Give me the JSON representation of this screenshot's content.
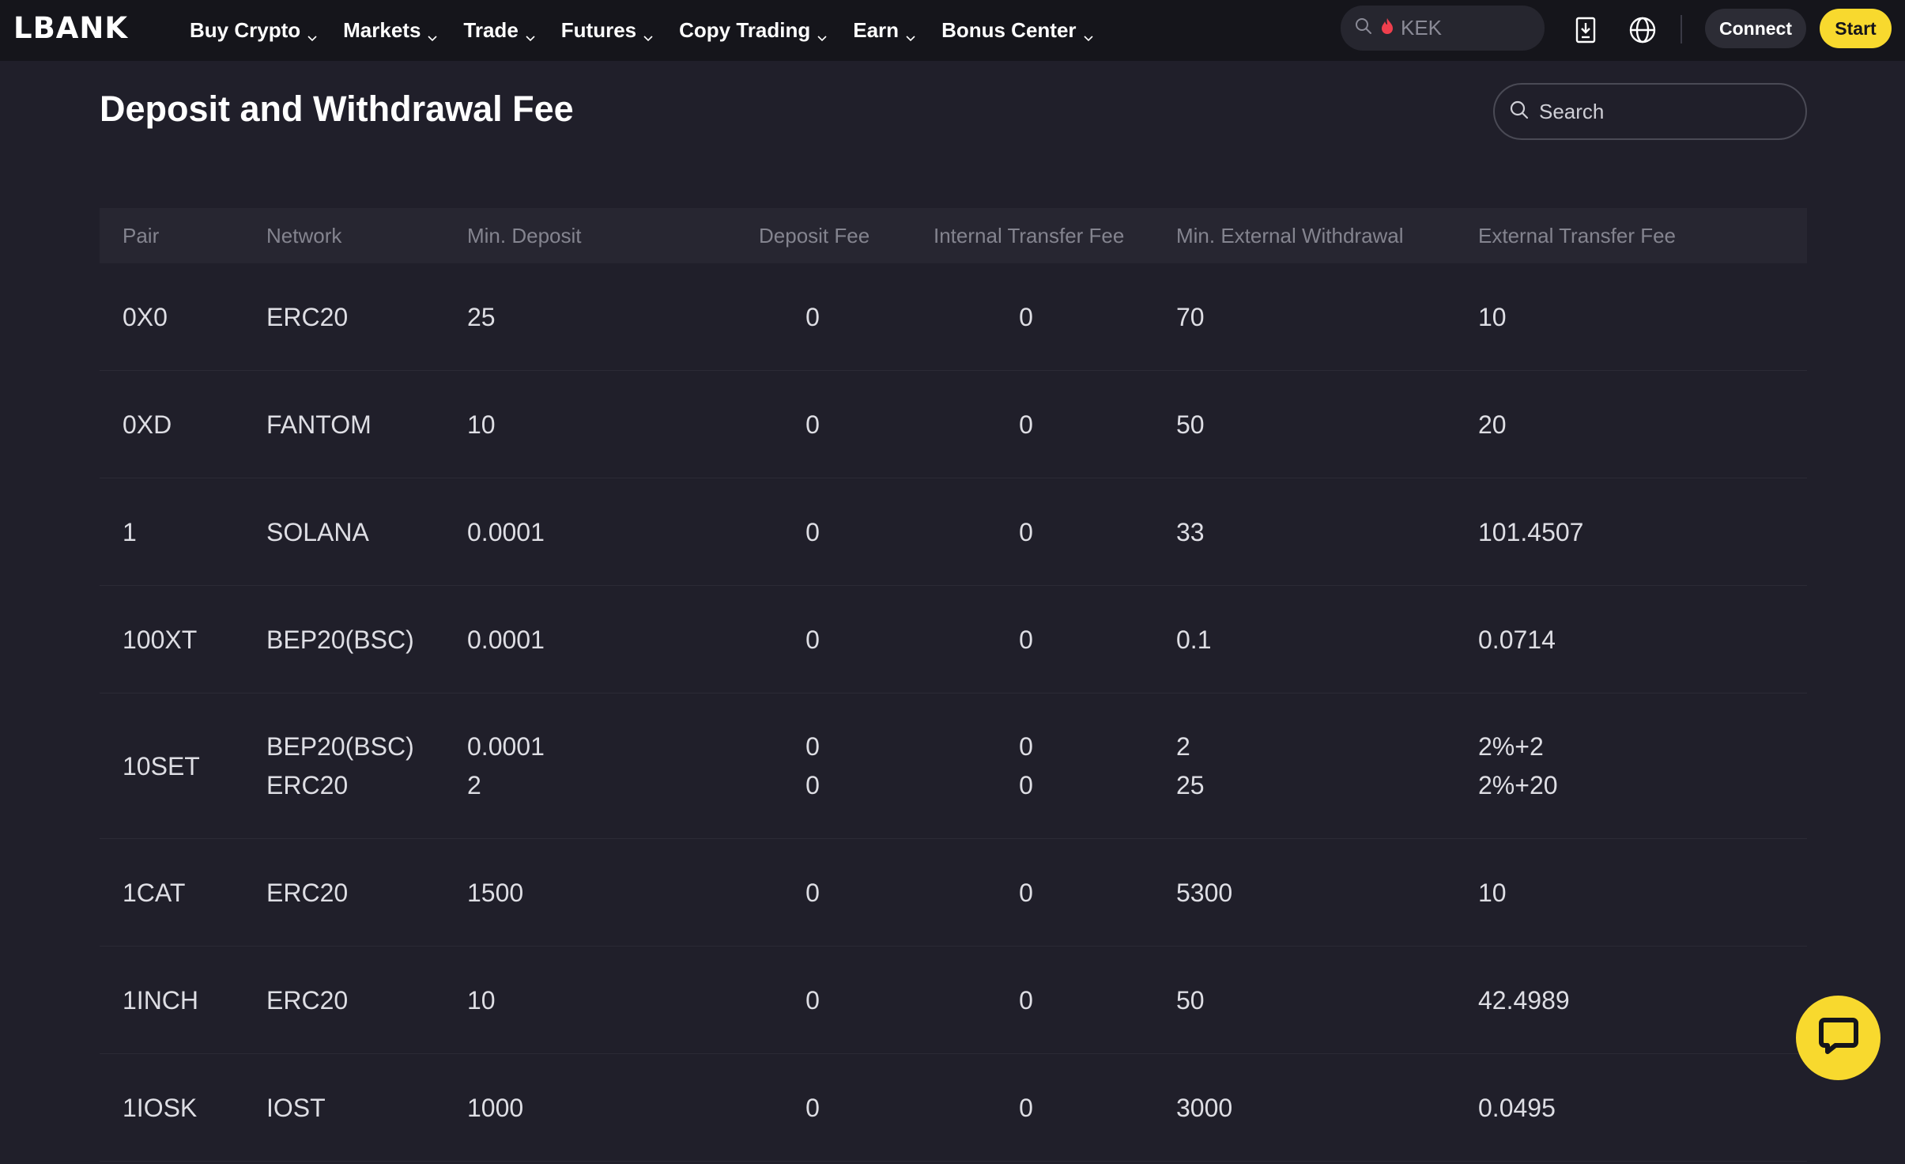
{
  "brand": {
    "logo_text": "LBANK",
    "accent": "#f8d92e"
  },
  "nav": {
    "items": [
      {
        "label": "Buy Crypto",
        "name": "nav-buy-crypto"
      },
      {
        "label": "Markets",
        "name": "nav-markets"
      },
      {
        "label": "Trade",
        "name": "nav-trade"
      },
      {
        "label": "Futures",
        "name": "nav-futures"
      },
      {
        "label": "Copy Trading",
        "name": "nav-copy-trading"
      },
      {
        "label": "Earn",
        "name": "nav-earn"
      },
      {
        "label": "Bonus Center",
        "name": "nav-bonus-center"
      }
    ],
    "search_hot_text": "KEK",
    "connect_label": "Connect",
    "start_label": "Start",
    "icons": [
      "search-icon",
      "fire-icon",
      "download-app-icon",
      "globe-icon"
    ]
  },
  "page": {
    "title": "Deposit and Withdrawal Fee",
    "search_placeholder": "Search"
  },
  "table": {
    "headers": [
      "Pair",
      "Network",
      "Min. Deposit",
      "Deposit Fee",
      "Internal Transfer Fee",
      "Min. External Withdrawal",
      "External Transfer Fee"
    ],
    "rows": [
      {
        "pair": "0X0",
        "networks": [
          "ERC20"
        ],
        "min_deposit": [
          "25"
        ],
        "deposit_fee": [
          "0"
        ],
        "internal_fee": [
          "0"
        ],
        "min_withdrawal": [
          "70"
        ],
        "external_fee": [
          "10"
        ]
      },
      {
        "pair": "0XD",
        "networks": [
          "FANTOM"
        ],
        "min_deposit": [
          "10"
        ],
        "deposit_fee": [
          "0"
        ],
        "internal_fee": [
          "0"
        ],
        "min_withdrawal": [
          "50"
        ],
        "external_fee": [
          "20"
        ]
      },
      {
        "pair": "1",
        "networks": [
          "SOLANA"
        ],
        "min_deposit": [
          "0.0001"
        ],
        "deposit_fee": [
          "0"
        ],
        "internal_fee": [
          "0"
        ],
        "min_withdrawal": [
          "33"
        ],
        "external_fee": [
          "101.4507"
        ]
      },
      {
        "pair": "100XT",
        "networks": [
          "BEP20(BSC)"
        ],
        "min_deposit": [
          "0.0001"
        ],
        "deposit_fee": [
          "0"
        ],
        "internal_fee": [
          "0"
        ],
        "min_withdrawal": [
          "0.1"
        ],
        "external_fee": [
          "0.0714"
        ]
      },
      {
        "pair": "10SET",
        "networks": [
          "BEP20(BSC)",
          "ERC20"
        ],
        "min_deposit": [
          "0.0001",
          "2"
        ],
        "deposit_fee": [
          "0",
          "0"
        ],
        "internal_fee": [
          "0",
          "0"
        ],
        "min_withdrawal": [
          "2",
          "25"
        ],
        "external_fee": [
          "2%+2",
          "2%+20"
        ]
      },
      {
        "pair": "1CAT",
        "networks": [
          "ERC20"
        ],
        "min_deposit": [
          "1500"
        ],
        "deposit_fee": [
          "0"
        ],
        "internal_fee": [
          "0"
        ],
        "min_withdrawal": [
          "5300"
        ],
        "external_fee": [
          "10"
        ]
      },
      {
        "pair": "1INCH",
        "networks": [
          "ERC20"
        ],
        "min_deposit": [
          "10"
        ],
        "deposit_fee": [
          "0"
        ],
        "internal_fee": [
          "0"
        ],
        "min_withdrawal": [
          "50"
        ],
        "external_fee": [
          "42.4989"
        ]
      },
      {
        "pair": "1IOSK",
        "networks": [
          "IOST"
        ],
        "min_deposit": [
          "1000"
        ],
        "deposit_fee": [
          "0"
        ],
        "internal_fee": [
          "0"
        ],
        "min_withdrawal": [
          "3000"
        ],
        "external_fee": [
          "0.0495"
        ]
      }
    ]
  },
  "chat": {
    "icon": "chat-support-icon"
  }
}
